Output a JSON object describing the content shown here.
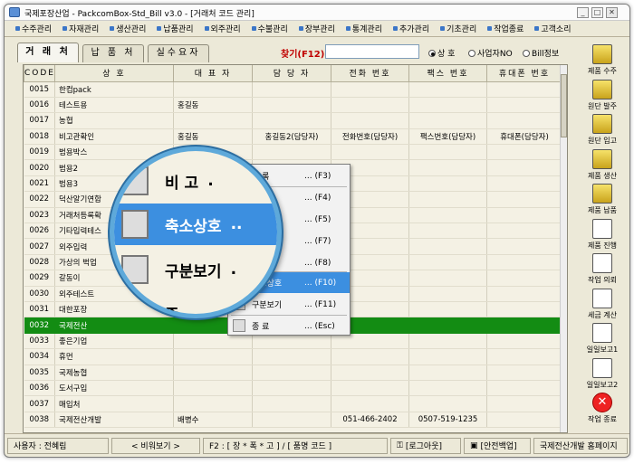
{
  "window": {
    "title": "국제포장산업 - PackcomBox-Std_Bill v3.0 - [거래처 코드 관리]"
  },
  "menu": [
    "수주관리",
    "자재관리",
    "생산관리",
    "납품관리",
    "외주관리",
    "수불관리",
    "장부관리",
    "통계관리",
    "추가관리",
    "기초관리",
    "작업종료",
    "고객소리"
  ],
  "tabs": [
    "거 래 처",
    "납 품 처",
    "실수요자"
  ],
  "search": {
    "label": "찾기(F12)",
    "value": ""
  },
  "search_options": [
    {
      "label": "상 호",
      "selected": true
    },
    {
      "label": "사업자NO",
      "selected": false
    },
    {
      "label": "Bill정보",
      "selected": false
    }
  ],
  "table": {
    "columns": [
      "CODE",
      "상 호",
      "대 표 자",
      "담 당 자",
      "전화 번호",
      "팩스 번호",
      "휴대폰 번호"
    ],
    "rows": [
      [
        "0015",
        "한컴pack",
        "",
        "",
        "",
        "",
        ""
      ],
      [
        "0016",
        "테스트용",
        "홍길동",
        "",
        "",
        "",
        ""
      ],
      [
        "0017",
        "농협",
        "",
        "",
        "",
        "",
        ""
      ],
      [
        "0018",
        "비고관확인",
        "홍길동",
        "홍길동2(담당자)",
        "전화번호(담당자)",
        "팩스번호(담당자)",
        "휴대폰(담당자)"
      ],
      [
        "0019",
        "범용박스",
        "범용",
        "",
        "",
        "",
        ""
      ],
      [
        "0020",
        "범용2",
        "",
        "",
        "",
        "",
        ""
      ],
      [
        "0021",
        "범용3",
        "",
        "",
        "",
        "",
        ""
      ],
      [
        "0022",
        "덕산알기연합",
        "",
        "",
        "",
        "",
        ""
      ],
      [
        "0023",
        "거래처등록확",
        "",
        "",
        "",
        "",
        ""
      ],
      [
        "0026",
        "기타입력테스",
        "",
        "",
        "",
        "",
        ""
      ],
      [
        "0027",
        "외주입력",
        "",
        "",
        "",
        "",
        ""
      ],
      [
        "0028",
        "가상의 벅업",
        "",
        "",
        "",
        "",
        ""
      ],
      [
        "0029",
        "갈동이",
        "",
        "",
        "",
        "",
        ""
      ],
      [
        "0030",
        "외주테스트",
        "",
        "",
        "",
        "",
        ""
      ],
      [
        "0031",
        "대한포장",
        "",
        "",
        "",
        "",
        ""
      ],
      [
        "0032",
        "국제전산",
        "",
        "",
        "",
        "",
        ""
      ],
      [
        "0033",
        "좋은기업",
        "",
        "",
        "",
        "",
        ""
      ],
      [
        "0034",
        "휴먼",
        "",
        "",
        "",
        "",
        ""
      ],
      [
        "0035",
        "국제농협",
        "",
        "",
        "",
        "",
        ""
      ],
      [
        "0036",
        "도서구입",
        "",
        "",
        "",
        "",
        ""
      ],
      [
        "0037",
        "매입처",
        "",
        "",
        "",
        "",
        ""
      ],
      [
        "0038",
        "국제전산개발",
        "배병수",
        "",
        "051-466-2402",
        "0507-519-1235",
        ""
      ]
    ],
    "selected_row": 15
  },
  "context_menu": [
    {
      "label": "등    록",
      "shortcut": "... (F3)"
    },
    {
      "label": "수    정",
      "shortcut": "... (F4)"
    },
    {
      "label": "삭    제",
      "shortcut": "... (F5)"
    },
    {
      "label": "인    쇄",
      "shortcut": "... (F7)"
    },
    {
      "label": "비    고",
      "shortcut": "... (F8)"
    },
    {
      "label": "축소상호",
      "shortcut": "... (F10)",
      "highlighted": true
    },
    {
      "label": "구분보기",
      "shortcut": "... (F11)"
    },
    {
      "label": "종    료",
      "shortcut": "... (Esc)"
    }
  ],
  "magnifier": [
    {
      "label": "비  고",
      "suffix": "."
    },
    {
      "label": "축소상호",
      "suffix": "..",
      "highlighted": true
    },
    {
      "label": "구분보기",
      "suffix": "."
    },
    {
      "label": "종",
      "suffix": ""
    }
  ],
  "sidebar": [
    "제품 수주",
    "원단 발주",
    "원단 입고",
    "제품 생산",
    "제품 납품",
    "제품 진행",
    "작업 의뢰",
    "세금 계산",
    "일일보고1",
    "일일보고2",
    "작업 종료"
  ],
  "status": {
    "user": "사용자 : 전혜림",
    "view": "< 비워보기 >",
    "hint": "F2 : [ 장 * 폭 * 고 ]   /   [ 품명 코드 ]",
    "logout": "[로그아웃]",
    "backup": "[안전백업]",
    "homepage": "국제전산개발 홈페이지"
  }
}
